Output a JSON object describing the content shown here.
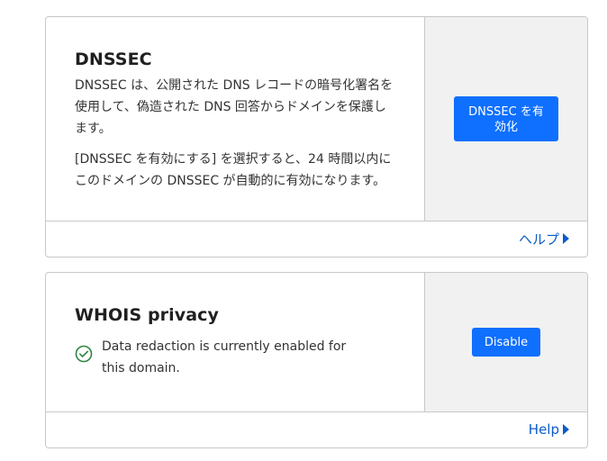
{
  "dnssec": {
    "title": "DNSSEC",
    "description_1": "DNSSEC は、公開された DNS レコードの暗号化署名を使用して、偽造された DNS 回答からドメインを保護します。",
    "description_2": "[DNSSEC を有効にする] を選択すると、24 時間以内にこのドメインの DNSSEC が自動的に有効になります。",
    "button_line_1": "DNSSEC を有",
    "button_line_2": "効化",
    "help_label": "ヘルプ"
  },
  "whois": {
    "title": "WHOIS privacy",
    "status_text": "Data redaction is currently enabled for this domain.",
    "button_label": "Disable",
    "help_label": "Help"
  },
  "colors": {
    "accent": "#0f6fff",
    "link": "#0b5cc9",
    "success": "#2e8540",
    "side_panel": "#f1f1f1"
  },
  "icons": {
    "status": "check-circle-icon",
    "help_caret": "caret-right-icon"
  }
}
